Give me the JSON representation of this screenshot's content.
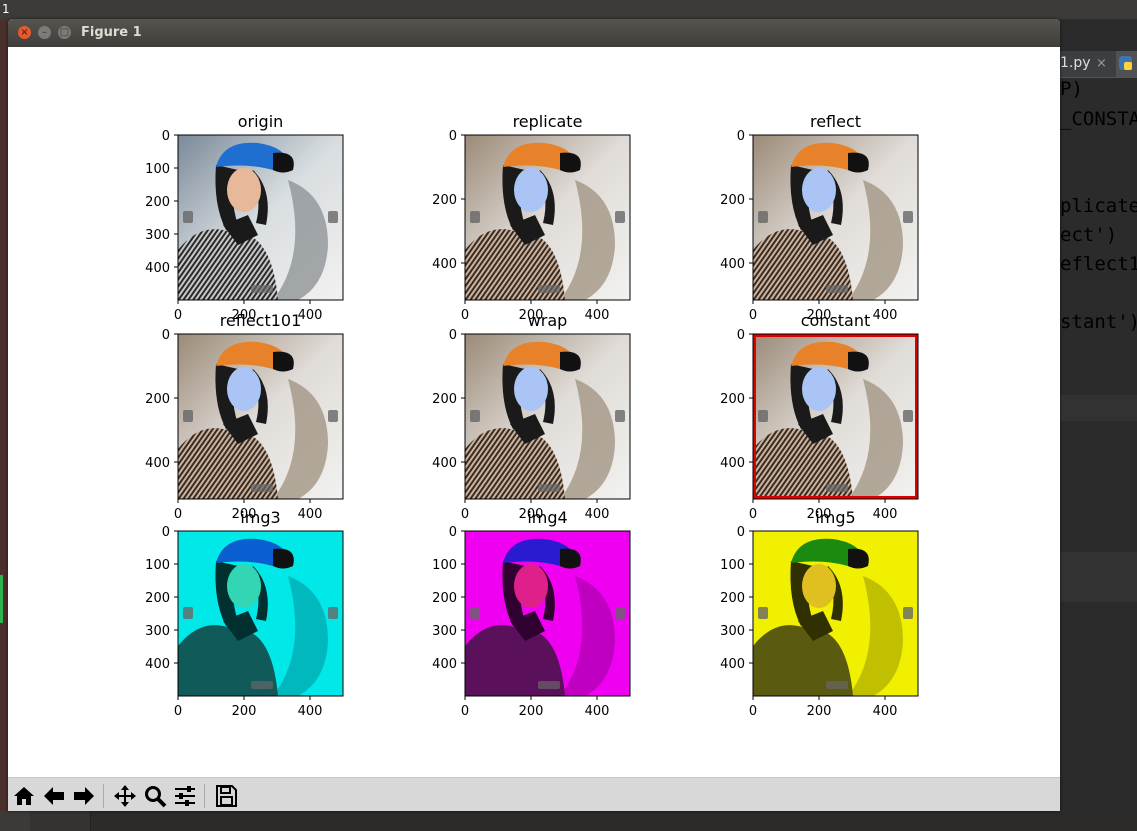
{
  "desktop": {
    "top_left_label": "1"
  },
  "window": {
    "title": "Figure 1"
  },
  "figure": {
    "subplots": [
      {
        "title": "origin",
        "yticks": [
          "0",
          "100",
          "200",
          "300",
          "400"
        ],
        "xticks": [
          "0",
          "200",
          "400"
        ],
        "effect": "original"
      },
      {
        "title": "replicate",
        "yticks": [
          "0",
          "200",
          "400"
        ],
        "xticks": [
          "0",
          "200",
          "400"
        ],
        "effect": "bgr"
      },
      {
        "title": "reflect",
        "yticks": [
          "0",
          "200",
          "400"
        ],
        "xticks": [
          "0",
          "200",
          "400"
        ],
        "effect": "bgr"
      },
      {
        "title": "reflect101",
        "yticks": [
          "0",
          "200",
          "400"
        ],
        "xticks": [
          "0",
          "200",
          "400"
        ],
        "effect": "bgr"
      },
      {
        "title": "wrap",
        "yticks": [
          "0",
          "200",
          "400"
        ],
        "xticks": [
          "0",
          "200",
          "400"
        ],
        "effect": "bgr"
      },
      {
        "title": "constant",
        "yticks": [
          "0",
          "200",
          "400"
        ],
        "xticks": [
          "0",
          "200",
          "400"
        ],
        "effect": "bgr-red-border"
      },
      {
        "title": "img3",
        "yticks": [
          "0",
          "100",
          "200",
          "300",
          "400"
        ],
        "xticks": [
          "0",
          "200",
          "400"
        ],
        "effect": "cyan"
      },
      {
        "title": "img4",
        "yticks": [
          "0",
          "100",
          "200",
          "300",
          "400"
        ],
        "xticks": [
          "0",
          "200",
          "400"
        ],
        "effect": "magenta"
      },
      {
        "title": "img5",
        "yticks": [
          "0",
          "100",
          "200",
          "300",
          "400"
        ],
        "xticks": [
          "0",
          "200",
          "400"
        ],
        "effect": "yellow"
      }
    ]
  },
  "toolbar": {
    "buttons": [
      {
        "name": "home-button",
        "icon": "home-icon"
      },
      {
        "name": "back-button",
        "icon": "arrow-left-icon"
      },
      {
        "name": "forward-button",
        "icon": "arrow-right-icon"
      },
      {
        "name": "pan-button",
        "icon": "move-icon"
      },
      {
        "name": "zoom-button",
        "icon": "magnifier-icon"
      },
      {
        "name": "subplots-button",
        "icon": "sliders-icon"
      },
      {
        "name": "save-button",
        "icon": "floppy-icon"
      }
    ]
  },
  "editor": {
    "tab_label": "1.py",
    "tab_close": "×",
    "lines": [
      {
        "text": "P)",
        "color": "#a9b7c6"
      },
      {
        "text": "_CONSTA",
        "color": "#a9b7c6"
      },
      {
        "text": "plicate",
        "color": "#6a8759"
      },
      {
        "text": "ect')",
        "color": "#6a8759"
      },
      {
        "text": "eflect1",
        "color": "#6a8759"
      },
      {
        "text": "stant')",
        "color": "#6a8759"
      }
    ]
  },
  "colors": {
    "constant_border": "#dd0000",
    "ide_bg": "#2b2b2b",
    "toolbar_bg": "#d8d8d8"
  }
}
